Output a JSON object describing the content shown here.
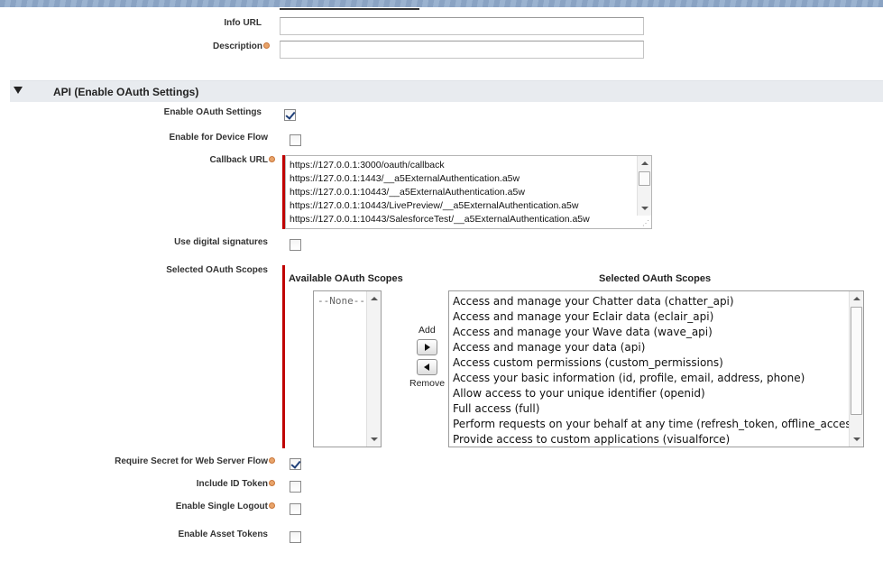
{
  "form": {
    "info_url": {
      "label": "Info URL",
      "value": ""
    },
    "description": {
      "label": "Description",
      "value": ""
    }
  },
  "section": {
    "title": "API (Enable OAuth Settings)"
  },
  "fields": {
    "enable_oauth": {
      "label": "Enable OAuth Settings",
      "checked": true
    },
    "device_flow": {
      "label": "Enable for Device Flow",
      "checked": false
    },
    "callback_url": {
      "label": "Callback URL",
      "lines": [
        "https://127.0.0.1:3000/oauth/callback",
        "https://127.0.0.1:1443/__a5ExternalAuthentication.a5w",
        "https://127.0.0.1:10443/__a5ExternalAuthentication.a5w",
        "https://127.0.0.1:10443/LivePreview/__a5ExternalAuthentication.a5w",
        "https://127.0.0.1:10443/SalesforceTest/__a5ExternalAuthentication.a5w"
      ]
    },
    "digital_signatures": {
      "label": "Use digital signatures",
      "checked": false
    },
    "selected_scopes_label": "Selected OAuth Scopes",
    "require_secret": {
      "label": "Require Secret for Web Server Flow",
      "checked": true
    },
    "include_id_token": {
      "label": "Include ID Token",
      "checked": false
    },
    "single_logout": {
      "label": "Enable Single Logout",
      "checked": false
    },
    "asset_tokens": {
      "label": "Enable Asset Tokens",
      "checked": false
    }
  },
  "scopes": {
    "available_header": "Available OAuth Scopes",
    "selected_header": "Selected OAuth Scopes",
    "available_items": [
      "--None--"
    ],
    "add_label": "Add",
    "remove_label": "Remove",
    "selected_items": [
      "Access and manage your Chatter data (chatter_api)",
      "Access and manage your Eclair data (eclair_api)",
      "Access and manage your Wave data (wave_api)",
      "Access and manage your data (api)",
      "Access custom permissions (custom_permissions)",
      "Access your basic information (id, profile, email, address, phone)",
      "Allow access to your unique identifier (openid)",
      "Full access (full)",
      "Perform requests on your behalf at any time (refresh_token, offline_access)",
      "Provide access to custom applications (visualforce)"
    ]
  },
  "colors": {
    "required": "#c00000",
    "section_bg": "#e8ebef",
    "help_icon": "#e8a46b"
  }
}
